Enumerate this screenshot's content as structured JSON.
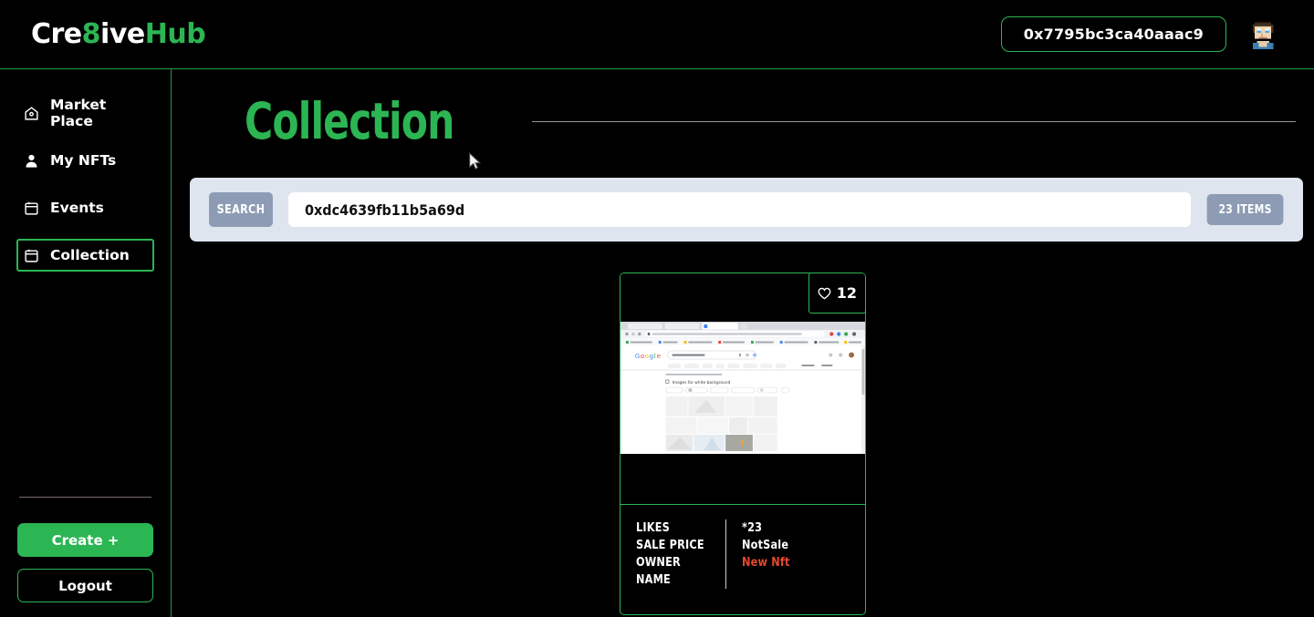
{
  "header": {
    "logo_part1": "Cre",
    "logo_part2": "8",
    "logo_part3": "ive",
    "logo_part4": "Hub",
    "wallet_address": "0x7795bc3ca40aaac9",
    "avatar_name": "user-avatar"
  },
  "sidebar": {
    "items": [
      {
        "label": "Market Place",
        "icon": "home-icon",
        "active": false
      },
      {
        "label": "My NFTs",
        "icon": "person-icon",
        "active": false
      },
      {
        "label": "Events",
        "icon": "calendar-icon",
        "active": false
      },
      {
        "label": "Collection",
        "icon": "calendar-icon",
        "active": true
      }
    ],
    "create_label": "Create +",
    "logout_label": "Logout"
  },
  "main": {
    "page_title": "Collection",
    "search": {
      "button_label": "SEARCH",
      "input_value": "0xdc4639fb11b5a69d",
      "placeholder": "Search",
      "items_badge": "23 ITEMS"
    },
    "card": {
      "likes_count": "12",
      "heart_icon": "heart-outline-icon",
      "image_caption": "Google Images search results for white background",
      "labels": [
        "LIKES",
        "SALE PRICE",
        "OWNER",
        "NAME"
      ],
      "values": [
        "*23",
        "NotSale",
        "New Nft"
      ]
    }
  },
  "colors": {
    "accent_green": "#2cb553",
    "background": "#000000",
    "panel_blue": "#dee5ef",
    "button_slate": "#8d9cb4",
    "value_red": "#e8482f"
  }
}
